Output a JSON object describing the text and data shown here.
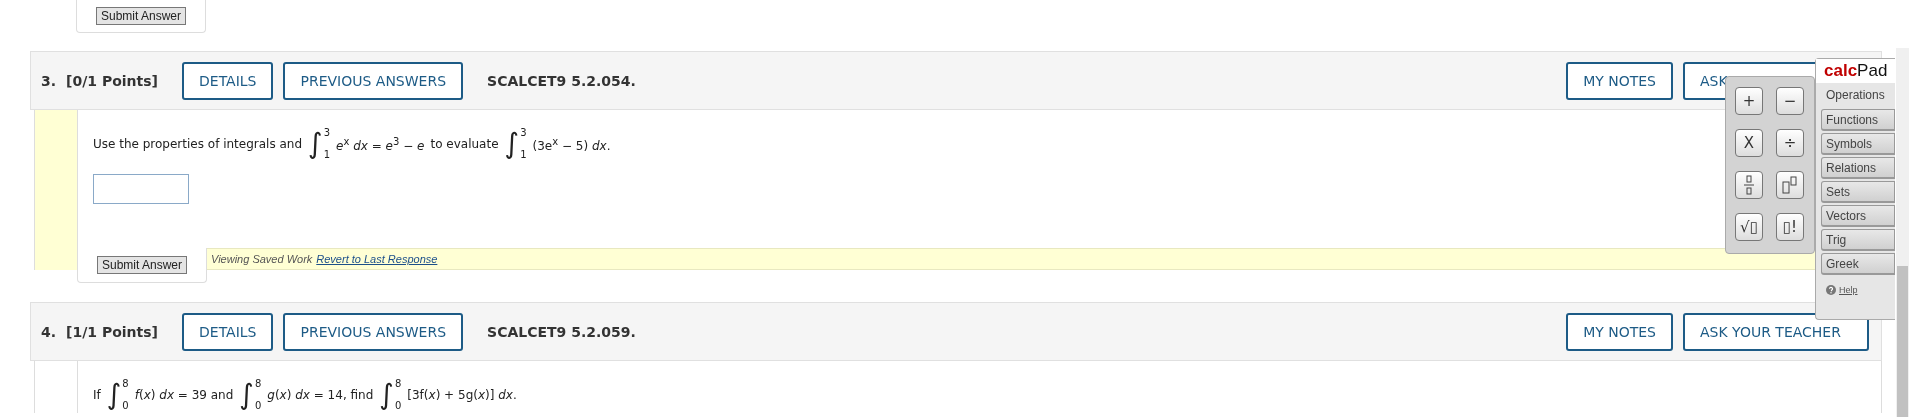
{
  "top_submit": {
    "label": "Submit Answer"
  },
  "questions": [
    {
      "number": "3.",
      "points": "[0/1 Points]",
      "buttons": [
        "DETAILS",
        "PREVIOUS ANSWERS"
      ],
      "code": "SCALCET9 5.2.054.",
      "right_buttons": [
        "MY NOTES",
        "ASK"
      ],
      "highlighted": true,
      "prompt": [
        {
          "kind": "text",
          "text": "Use the properties of integrals and"
        },
        {
          "kind": "integral",
          "sign": "∫",
          "upper": "3",
          "lower": "1"
        },
        {
          "kind": "math",
          "text": "*e*$^{x}$ *dx* = *e*$^{3}$ − *e*"
        },
        {
          "kind": "text",
          "text": "to evaluate"
        },
        {
          "kind": "integral",
          "sign": "∫",
          "upper": "3",
          "lower": "1"
        },
        {
          "kind": "math",
          "text": "(3e$^{x}$ − 5) *dx*."
        }
      ],
      "answer_field": true,
      "saved_notice": {
        "text": "Viewing Saved Work",
        "link": "Revert to Last Response"
      },
      "submit": "Submit Answer"
    },
    {
      "number": "4.",
      "points": "[1/1 Points]",
      "buttons": [
        "DETAILS",
        "PREVIOUS ANSWERS"
      ],
      "code": "SCALCET9 5.2.059.",
      "right_buttons": [
        "MY NOTES",
        "ASK YOUR TEACHER"
      ],
      "highlighted": false,
      "prompt": [
        {
          "kind": "text",
          "text": "If"
        },
        {
          "kind": "integral",
          "sign": "∫",
          "upper": "8",
          "lower": "0"
        },
        {
          "kind": "math",
          "text": "*f*(*x*) *dx* = 39 and"
        },
        {
          "kind": "integral",
          "sign": "∫",
          "upper": "8",
          "lower": "0"
        },
        {
          "kind": "math",
          "text": "*g*(*x*) *dx* = 14, find"
        },
        {
          "kind": "integral",
          "sign": "∫",
          "upper": "8",
          "lower": "0"
        },
        {
          "kind": "math",
          "text": "[3f(*x*) + 5g(*x*)] *dx*."
        }
      ]
    }
  ],
  "calcpad": {
    "title": "**calc**Pad",
    "keys": [
      {
        "kind": "text",
        "label": "+"
      },
      {
        "kind": "text",
        "label": "−"
      },
      {
        "kind": "text",
        "label": "X"
      },
      {
        "kind": "text",
        "label": "÷"
      },
      {
        "kind": "fraction"
      },
      {
        "kind": "power"
      },
      {
        "kind": "text",
        "label": "√▯"
      },
      {
        "kind": "text",
        "label": "▯!"
      }
    ],
    "tabs": [
      {
        "label": "Operations",
        "selected": true
      },
      {
        "label": "Functions",
        "selected": false
      },
      {
        "label": "Symbols",
        "selected": false
      },
      {
        "label": "Relations",
        "selected": false
      },
      {
        "label": "Sets",
        "selected": false
      },
      {
        "label": "Vectors",
        "selected": false
      },
      {
        "label": "Trig",
        "selected": false
      },
      {
        "label": "Greek",
        "selected": false
      }
    ],
    "help": "Help"
  }
}
